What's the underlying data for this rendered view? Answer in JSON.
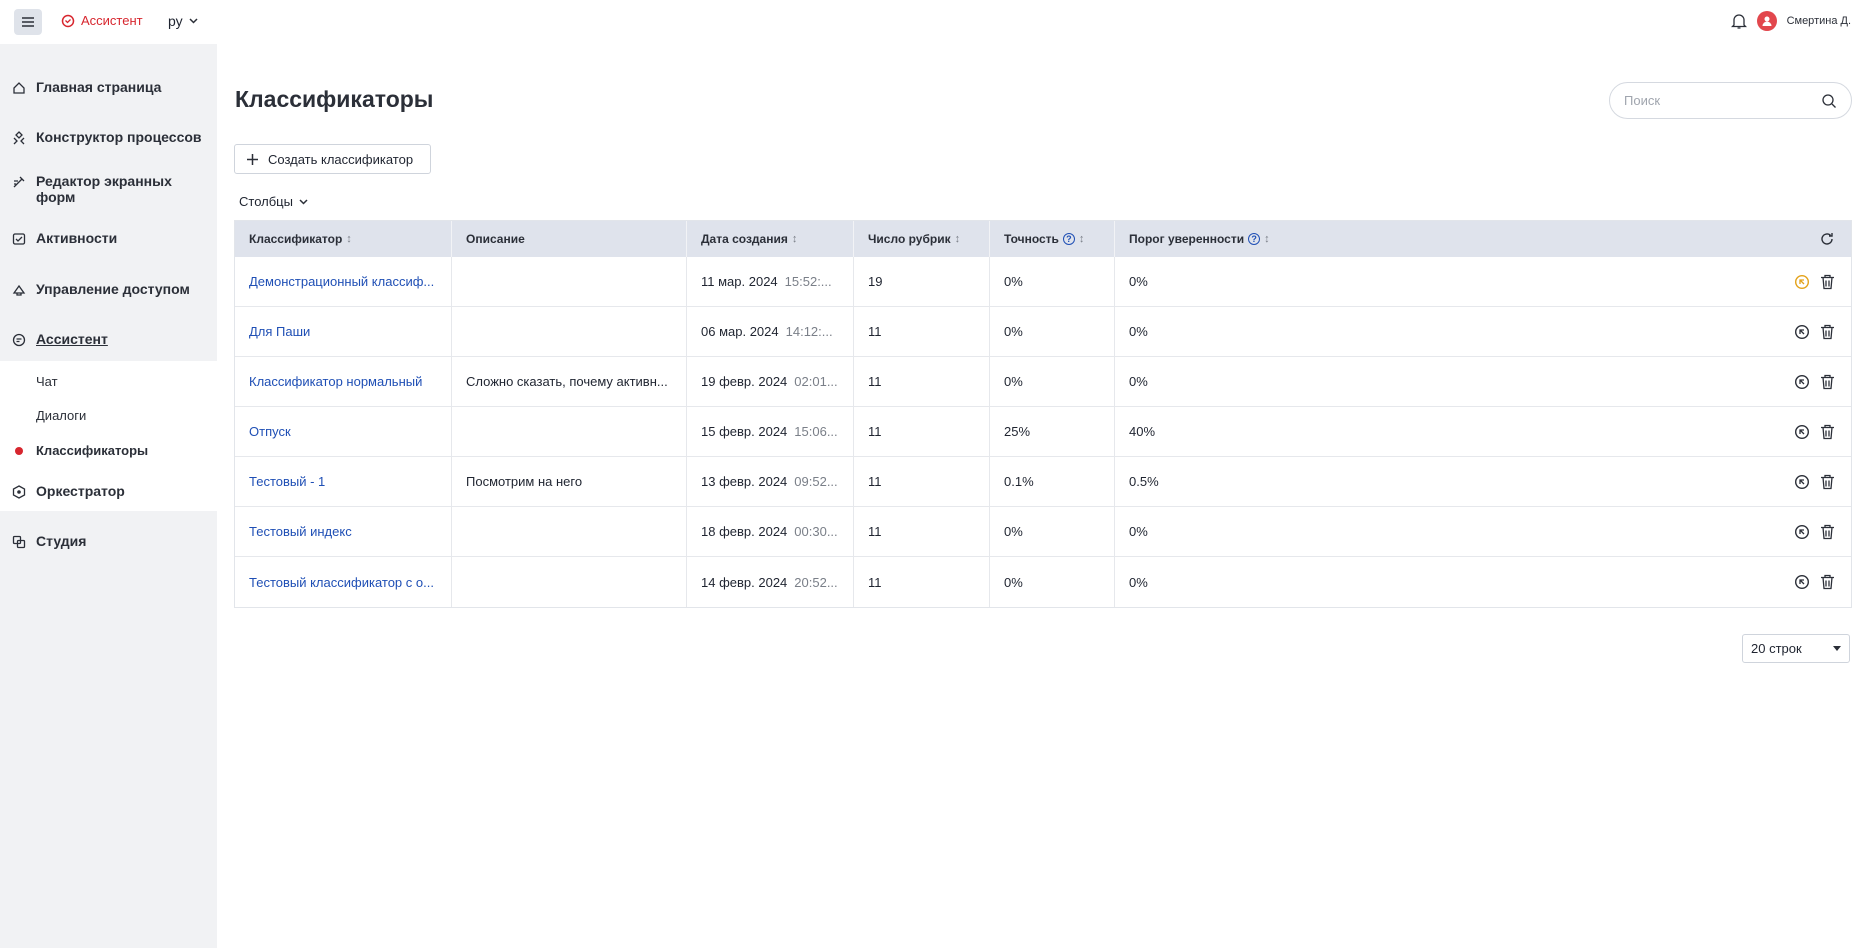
{
  "header": {
    "app_name": "Ассистент",
    "language": "ру",
    "user_name": "Смертина Д."
  },
  "sidebar": {
    "items": [
      {
        "label": "Главная страница",
        "icon": "home-icon"
      },
      {
        "label": "Конструктор процессов",
        "icon": "process-icon"
      },
      {
        "label": "Редактор экранных форм",
        "icon": "form-editor-icon"
      },
      {
        "label": "Активности",
        "icon": "activity-icon"
      },
      {
        "label": "Управление доступом",
        "icon": "access-icon"
      },
      {
        "label": "Ассистент",
        "icon": "assistant-icon"
      },
      {
        "label": "Оркестратор",
        "icon": "orchestrator-icon"
      },
      {
        "label": "Студия",
        "icon": "studio-icon"
      }
    ],
    "sub_items": [
      "Чат",
      "Диалоги",
      "Классификаторы"
    ],
    "accent_color": "#d7262e"
  },
  "page": {
    "title": "Классификаторы",
    "search_placeholder": "Поиск",
    "create_button": "Создать классификатор",
    "columns_button": "Столбцы",
    "rows_per_page": "20 строк"
  },
  "table": {
    "headers": {
      "classifier": "Классификатор",
      "description": "Описание",
      "created": "Дата создания",
      "rubrics": "Число рубрик",
      "accuracy": "Точность",
      "threshold": "Порог уверенности"
    },
    "rows": [
      {
        "name": "Демонстрационный классиф...",
        "description": "",
        "date": "11 мар. 2024",
        "time": "15:52:...",
        "rubrics": "19",
        "accuracy": "0%",
        "threshold": "0%"
      },
      {
        "name": "Для Паши",
        "description": "",
        "date": "06 мар. 2024",
        "time": "14:12:...",
        "rubrics": "11",
        "accuracy": "0%",
        "threshold": "0%"
      },
      {
        "name": "Классификатор нормальный",
        "description": "Сложно сказать, почему активн...",
        "date": "19 февр. 2024",
        "time": "02:01...",
        "rubrics": "11",
        "accuracy": "0%",
        "threshold": "0%"
      },
      {
        "name": "Отпуск",
        "description": "",
        "date": "15 февр. 2024",
        "time": "15:06...",
        "rubrics": "11",
        "accuracy": "25%",
        "threshold": "40%"
      },
      {
        "name": "Тестовый - 1",
        "description": "Посмотрим на него",
        "date": "13 февр. 2024",
        "time": "09:52...",
        "rubrics": "11",
        "accuracy": "0.1%",
        "threshold": "0.5%"
      },
      {
        "name": "Тестовый индекс",
        "description": "",
        "date": "18 февр. 2024",
        "time": "00:30...",
        "rubrics": "11",
        "accuracy": "0%",
        "threshold": "0%"
      },
      {
        "name": "Тестовый классификатор с о...",
        "description": "",
        "date": "14 февр. 2024",
        "time": "20:52...",
        "rubrics": "11",
        "accuracy": "0%",
        "threshold": "0%"
      }
    ]
  }
}
